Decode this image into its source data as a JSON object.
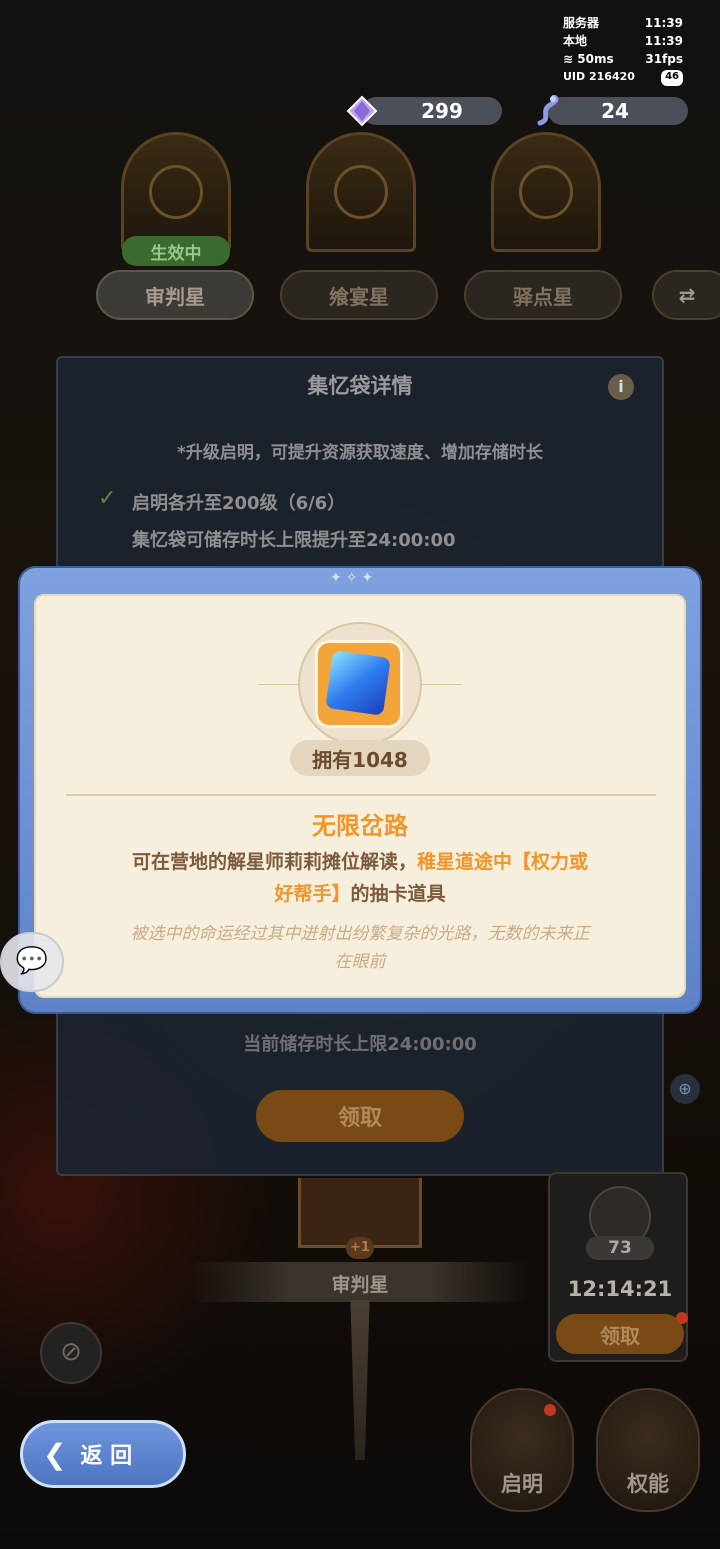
{
  "status": {
    "server_label": "服务器",
    "server_time": "11:39",
    "local_label": "本地",
    "local_time": "11:39",
    "ping": "50ms",
    "fps": "31fps",
    "uid": "UID 216420",
    "battery": "46"
  },
  "currency": {
    "gems": "299",
    "tickets": "24"
  },
  "tabs": [
    {
      "label": "审判星",
      "status": "生效中"
    },
    {
      "label": "飨宴星"
    },
    {
      "label": "驿点星"
    }
  ],
  "bg_panel": {
    "title": "集忆袋详情",
    "hint": "*升级启明，可提升资源获取速度、增加存储时长",
    "requirement": "启明各升至200级（6/6）",
    "effect": "集忆袋可储存时长上限提升至24:00:00",
    "current_limit": "当前储存时长上限24:00:00",
    "claim": "领取"
  },
  "modal": {
    "owned": "拥有1048",
    "name": "无限岔路",
    "desc_plain": "可在营地的解星师莉莉摊位解读，",
    "desc_highlight_1": "稚星道途中【权力或",
    "desc_highlight_2": "好帮手】",
    "desc_suffix": "的抽卡道具",
    "flavor_1": "被选中的命运经过其中迸射出纷繁复杂的光路，无数的未来正",
    "flavor_2": "在眼前"
  },
  "side_widget": {
    "count": "73",
    "timer": "12:14:21",
    "claim": "领取"
  },
  "bottom": {
    "star_label": "审判星",
    "star_level": "+1",
    "back": "返 回",
    "qiming": "启明",
    "quanneng": "权能"
  },
  "colors": {
    "accent_orange": "#f0952a",
    "modal_frame": "#6e92d6",
    "modal_bg": "#f7efdd",
    "text_brown": "#7d5a3b"
  }
}
